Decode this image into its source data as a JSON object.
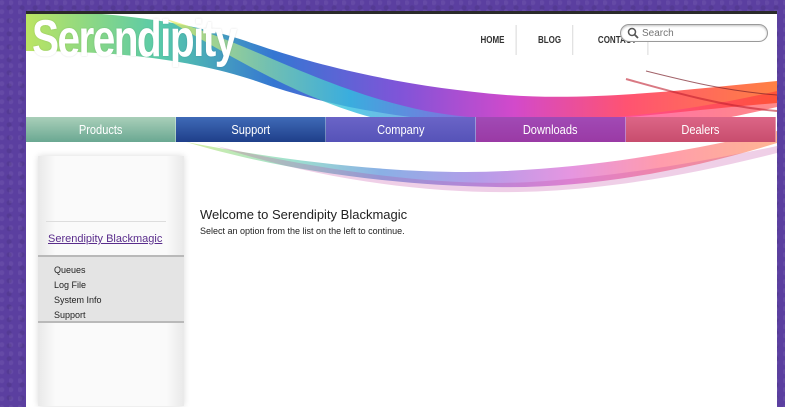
{
  "brand": {
    "logo_text": "Serendipity"
  },
  "top_nav": {
    "items": [
      "HOME",
      "BLOG",
      "CONTACT"
    ]
  },
  "search": {
    "placeholder": "Search"
  },
  "main_nav": {
    "tabs": [
      "Products",
      "Support",
      "Company",
      "Downloads",
      "Dealers"
    ],
    "active": "Support"
  },
  "sidebar": {
    "title": "Serendipity Blackmagic",
    "items": [
      "Queues",
      "Log File",
      "System Info",
      "Support"
    ]
  },
  "content": {
    "heading": "Welcome to Serendipity Blackmagic",
    "message": "Select an option from the list on the left to continue."
  },
  "colors": {
    "background": "#5b3fa0",
    "link": "#5a2d8c"
  }
}
